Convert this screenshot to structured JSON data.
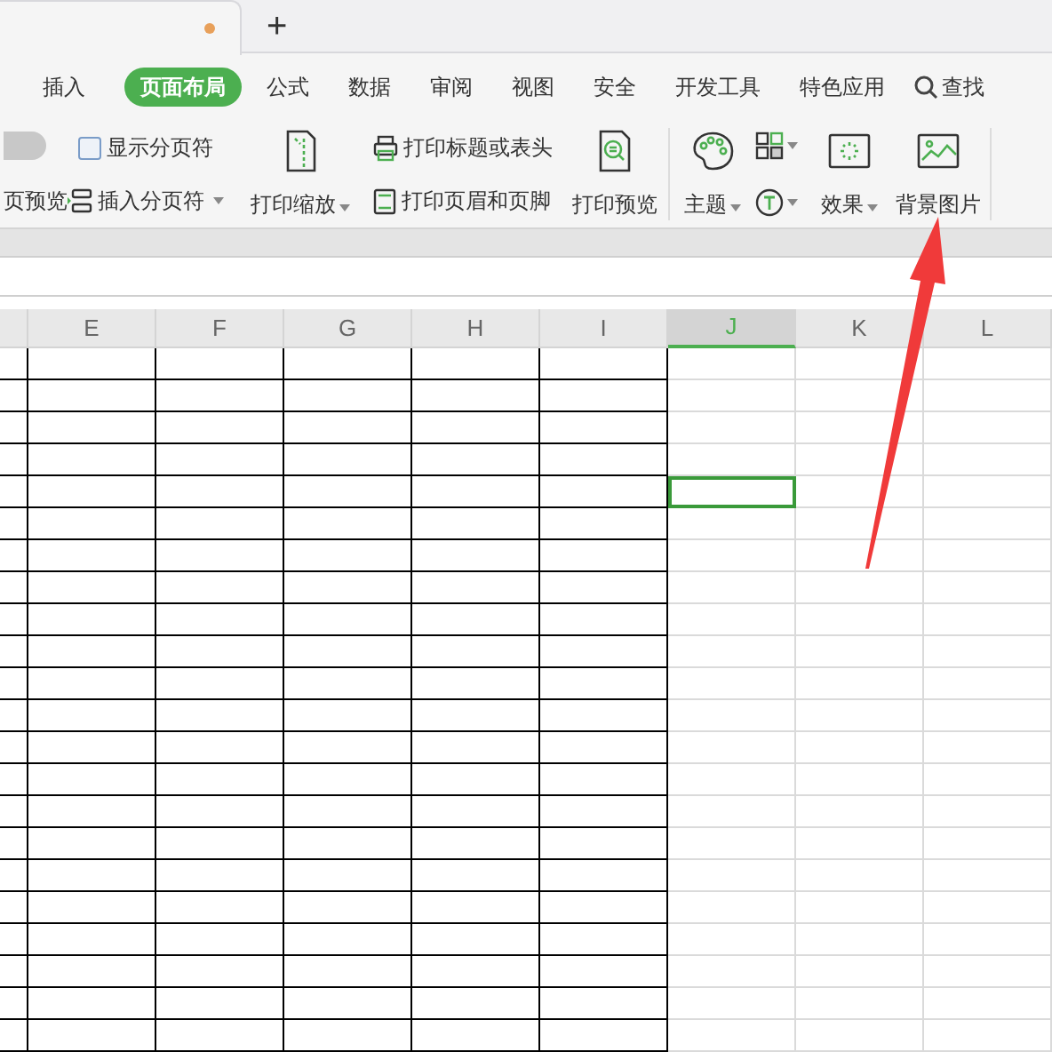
{
  "tab_bar": {
    "document_tab": {
      "unsaved": true
    },
    "new_tab_button": "+"
  },
  "menu": [
    {
      "label": "插入",
      "selected": false
    },
    {
      "label": "页面布局",
      "selected": true
    },
    {
      "label": "公式",
      "selected": false
    },
    {
      "label": "数据",
      "selected": false
    },
    {
      "label": "审阅",
      "selected": false
    },
    {
      "label": "视图",
      "selected": false
    },
    {
      "label": "安全",
      "selected": false
    },
    {
      "label": "开发工具",
      "selected": false
    },
    {
      "label": "特色应用",
      "selected": false
    }
  ],
  "search": {
    "label": "查找"
  },
  "toolbar": {
    "page_preview": {
      "on": false,
      "label": "页预览"
    },
    "show_page_breaks": {
      "label": "显示分页符",
      "checked": false
    },
    "insert_page_break": "插入分页符",
    "print_scale": "打印缩放",
    "print_titles": "打印标题或表头",
    "print_header_footer": "打印页眉和页脚",
    "print_preview": "打印预览",
    "theme": "主题",
    "effects": "效果",
    "background_image": "背景图片"
  },
  "sheet": {
    "columns": [
      {
        "bordered": true,
        "selected": false
      },
      {
        "header": "E",
        "bordered": true,
        "selected": false
      },
      {
        "header": "F",
        "bordered": true,
        "selected": false
      },
      {
        "header": "G",
        "bordered": true,
        "selected": false
      },
      {
        "header": "H",
        "bordered": true,
        "selected": false
      },
      {
        "header": "I",
        "bordered": true,
        "selected": false
      },
      {
        "header": "J",
        "bordered": false,
        "selected": true
      },
      {
        "header": "K",
        "bordered": false,
        "selected": false
      },
      {
        "header": "L",
        "bordered": false,
        "selected": false
      }
    ],
    "rows": [
      {
        "selected": false
      },
      {
        "selected": false
      },
      {
        "selected": false
      },
      {
        "selected": false
      },
      {
        "selected": true
      },
      {
        "selected": false
      },
      {
        "selected": false
      },
      {
        "selected": false
      },
      {
        "selected": false
      },
      {
        "selected": false
      },
      {
        "selected": false
      },
      {
        "selected": false
      },
      {
        "selected": false
      },
      {
        "selected": false
      },
      {
        "selected": false
      },
      {
        "selected": false
      },
      {
        "selected": false
      },
      {
        "selected": false
      },
      {
        "selected": false
      },
      {
        "selected": false
      },
      {
        "selected": false
      },
      {
        "selected": false
      }
    ]
  }
}
